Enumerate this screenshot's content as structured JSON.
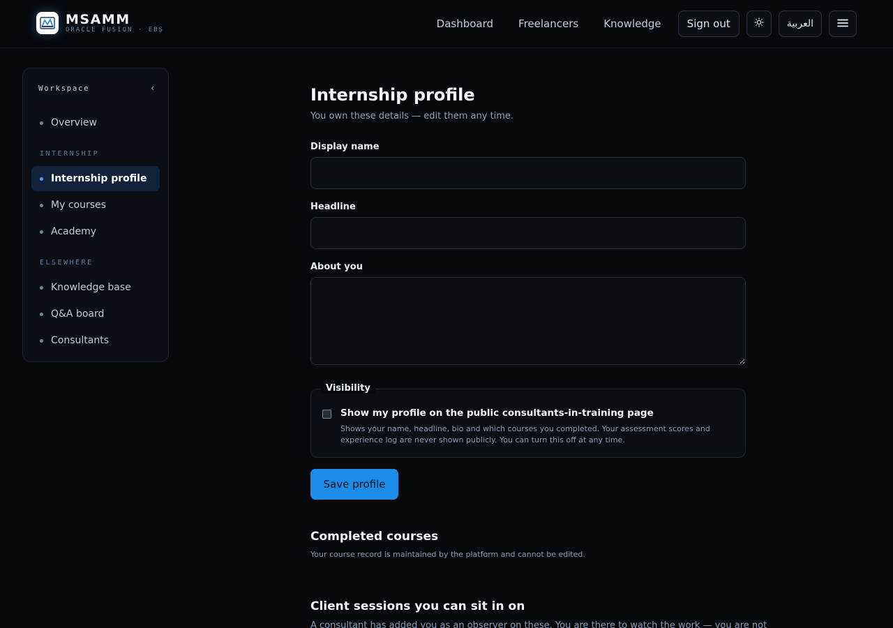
{
  "brand": {
    "name": "MSAMM",
    "subtitle": "ORACLE FUSION · EBS"
  },
  "nav": {
    "links": [
      "Dashboard",
      "Freelancers",
      "Knowledge"
    ],
    "sign_out": "Sign out",
    "language": "العربية",
    "icons": {
      "theme": "sun-icon",
      "menu": "hamburger-menu-icon"
    }
  },
  "sidebar": {
    "title": "Workspace",
    "collapse_glyph": "‹",
    "items": [
      {
        "label": "Overview"
      },
      {
        "section": "INTERNSHIP"
      },
      {
        "label": "Internship profile",
        "active": true
      },
      {
        "label": "My courses"
      },
      {
        "label": "Academy"
      },
      {
        "section": "ELSEWHERE"
      },
      {
        "label": "Knowledge base"
      },
      {
        "label": "Q&A board"
      },
      {
        "label": "Consultants"
      }
    ]
  },
  "main": {
    "title": "Internship profile",
    "subtitle": "You own these details — edit them any time.",
    "fields": {
      "display_name": {
        "label": "Display name",
        "value": "",
        "placeholder": ""
      },
      "headline": {
        "label": "Headline",
        "value": "",
        "placeholder": ""
      },
      "about": {
        "label": "About you",
        "value": "",
        "placeholder": ""
      }
    },
    "visibility": {
      "legend": "Visibility",
      "checkbox_label": "Show my profile on the public consultants-in-training page",
      "checked": false,
      "help": "Shows your name, headline, bio and which courses you completed. Your assessment scores and experience log are never shown publicly. You can turn this off at any time."
    },
    "save_label": "Save profile",
    "completed": {
      "title": "Completed courses",
      "subtitle": "Your course record is maintained by the platform and cannot be edited."
    },
    "sessions": {
      "title": "Client sessions you can sit in on",
      "subtitle": "A consultant has added you as an observer on these. You are there to watch the work — you are not"
    }
  },
  "colors": {
    "background": "#07090d",
    "accent": "#1c8ce8",
    "active_item": "#10233a"
  }
}
